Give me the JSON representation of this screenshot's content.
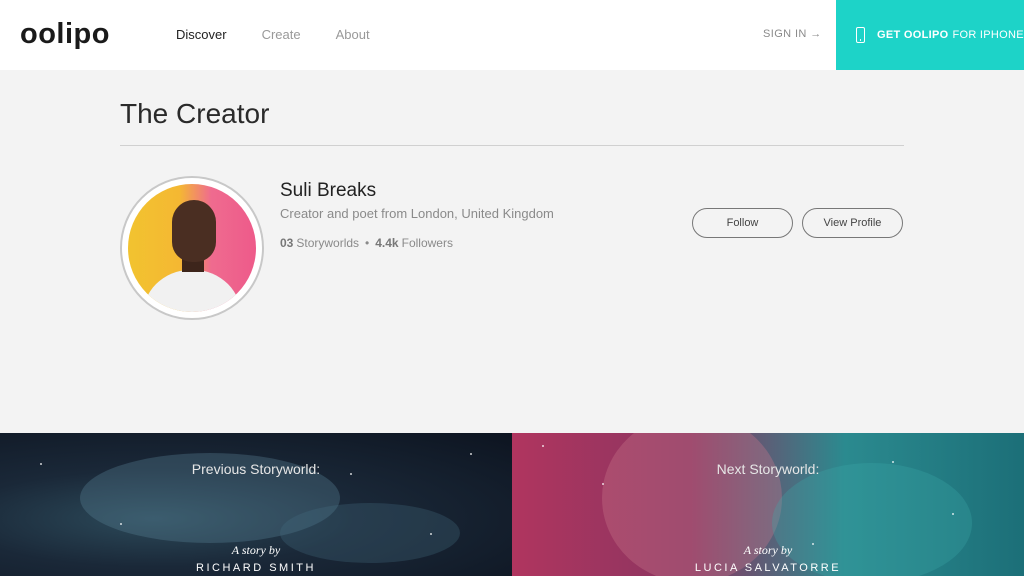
{
  "header": {
    "logo": "oolipo",
    "nav": [
      {
        "label": "Discover",
        "active": true
      },
      {
        "label": "Create",
        "active": false
      },
      {
        "label": "About",
        "active": false
      }
    ],
    "signin": "SIGN IN →",
    "cta_bold": "GET OOLIPO",
    "cta_rest": "FOR IPHONE",
    "accent_color": "#1dd3c8"
  },
  "creator_section": {
    "title": "The Creator",
    "name": "Suli Breaks",
    "bio": "Creator and poet from London, United Kingdom",
    "storyworlds_count": "03",
    "storyworlds_label": "Storyworlds",
    "separator": "•",
    "followers_count": "4.4k",
    "followers_label": "Followers",
    "follow_button": "Follow",
    "profile_button": "View Profile"
  },
  "previous": {
    "label": "Previous Storyworld:",
    "by": "A story by",
    "author": "RICHARD SMITH"
  },
  "next": {
    "label": "Next Storyworld:",
    "by": "A story by",
    "author": "LUCIA SALVATORRE"
  }
}
